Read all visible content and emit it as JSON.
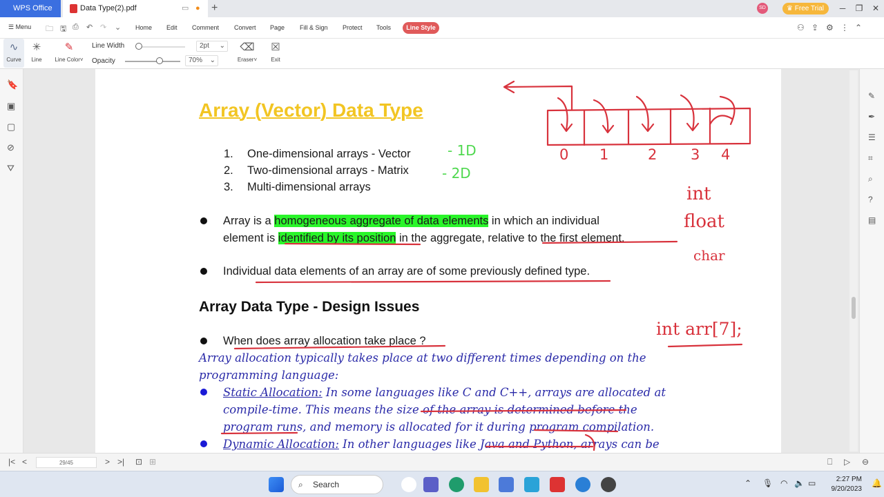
{
  "window": {
    "home_tab": "WPS Office",
    "doc_tab": "Data Type(2).pdf",
    "new_tab": "+",
    "free_trial": "Free Trial",
    "avatar": "SD"
  },
  "menubar": {
    "menu": "Menu",
    "tabs": [
      "Home",
      "Edit",
      "Comment",
      "Convert",
      "Page",
      "Fill & Sign",
      "Protect",
      "Tools"
    ],
    "active_tab": "Line Style"
  },
  "ribbon": {
    "curve": "Curve",
    "line": "Line",
    "line_color": "Line Color",
    "line_width_label": "Line Width",
    "line_width_value": "2pt",
    "opacity_label": "Opacity",
    "opacity_value": "70%",
    "eraser": "Eraser",
    "exit": "Exit"
  },
  "document": {
    "title": "Array (Vector) Data Type",
    "list": [
      {
        "num": "1.",
        "text": "One-dimensional arrays - Vector"
      },
      {
        "num": "2.",
        "text": "Two-dimensional arrays - Matrix"
      },
      {
        "num": "3.",
        "text": "Multi-dimensional arrays"
      }
    ],
    "p1": {
      "a": "Array is a ",
      "hl1": "homogeneous aggregate of data elements",
      "b": " in which an individual",
      "c": "element is ",
      "hl2": "identified by its position",
      "d": " in the aggregate, relative to the first element."
    },
    "p2": "Individual data elements of an array are of some previously defined type.",
    "h2": "Array Data Type - Design Issues",
    "q1": "When does array allocation take place ?",
    "ans1": "Array allocation typically takes place at two different times depending on the",
    "ans2": "programming language:",
    "static": {
      "label": "Static Allocation:",
      "line1": " In some languages like C and C++, arrays are allocated at",
      "line2": "compile-time. This means the size of the array is determined before the",
      "line3": "program runs, and memory is allocated for it during program compilation."
    },
    "dynamic": {
      "label": "Dynamic Allocation:",
      "line1": " In other languages like Java and Python, arrays can be"
    }
  },
  "annotations": {
    "green1": "- 1D",
    "green2": "- 2D",
    "indices": [
      "0",
      "1",
      "2",
      "3",
      "4"
    ],
    "types": [
      "int",
      "float",
      "char"
    ],
    "decl": "int arr[7];",
    "ink_red": "#d8323c",
    "ink_green": "#4fd84f"
  },
  "bottombar": {
    "page": "29/45"
  },
  "taskbar": {
    "search": "Search",
    "time": "2:27 PM",
    "date": "9/20/2023"
  }
}
